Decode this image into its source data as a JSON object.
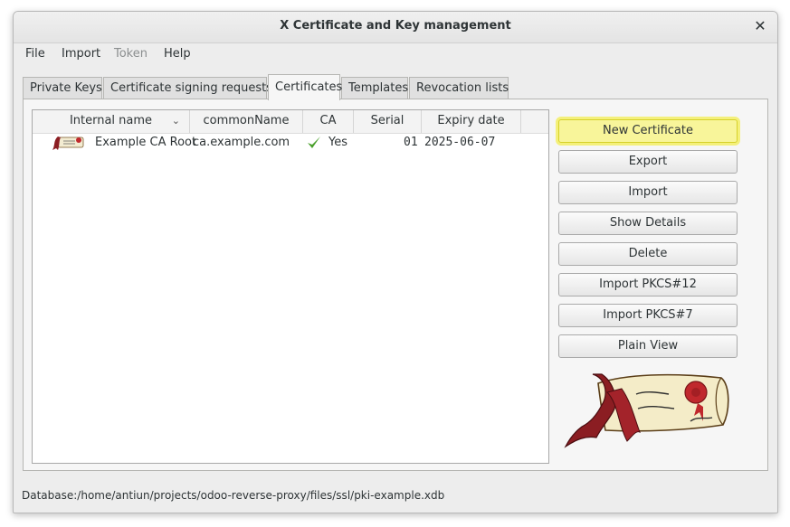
{
  "window": {
    "title": "X Certificate and Key management"
  },
  "menu": {
    "file": "File",
    "import": "Import",
    "token": "Token",
    "help": "Help"
  },
  "tabs": [
    {
      "label": "Private Keys"
    },
    {
      "label": "Certificate signing requests"
    },
    {
      "label": "Certificates"
    },
    {
      "label": "Templates"
    },
    {
      "label": "Revocation lists"
    }
  ],
  "active_tab": "Certificates",
  "table": {
    "columns": [
      "Internal name",
      "commonName",
      "CA",
      "Serial",
      "Expiry date"
    ],
    "rows": [
      {
        "internal_name": "Example CA Root",
        "common_name": "ca.example.com",
        "ca": "Yes",
        "serial": "01",
        "expiry": "2025-06-07"
      }
    ]
  },
  "buttons": {
    "new_certificate": "New Certificate",
    "export": "Export",
    "import": "Import",
    "show_details": "Show Details",
    "delete": "Delete",
    "import_pkcs12": "Import PKCS#12",
    "import_pkcs7": "Import PKCS#7",
    "plain_view": "Plain View"
  },
  "status": "Database:/home/antiun/projects/odoo-reverse-proxy/files/ssl/pki-example.xdb",
  "colors": {
    "highlight": "#f8f59a",
    "check": "#4aa02c",
    "seal": "#c0282d"
  }
}
